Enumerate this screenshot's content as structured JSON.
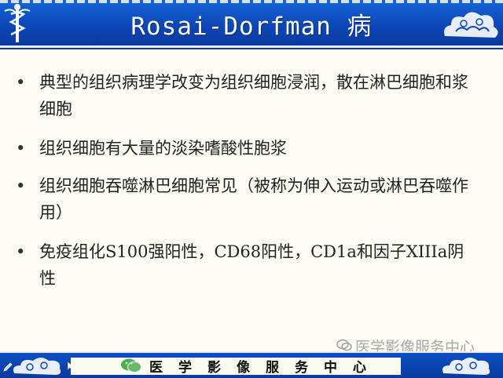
{
  "slide": {
    "title": "Rosai-Dorfman 病",
    "bullets": [
      {
        "marker": "•",
        "text": "典型的组织病理学改变为组织细胞浸润，散在淋巴细胞和浆细胞"
      },
      {
        "marker": "•",
        "text": "组织细胞有大量的淡染嗜酸性胞浆"
      },
      {
        "marker": "•",
        "text": "组织细胞吞噬淋巴细胞常见（被称为伸入运动或淋巴吞噬作用）"
      },
      {
        "marker": "•",
        "text": "免疫组化S100强阳性，CD68阳性，CD1a和因子XIIIa阴性"
      }
    ]
  },
  "footer": {
    "text": "医学影像服务中心"
  },
  "watermark": {
    "text": "医学影像服务中心"
  },
  "colors": {
    "header_blue": "#0d47b8",
    "background": "#fdfdf5",
    "text": "#222222"
  },
  "icons": [
    "caduceus-icon",
    "cloud-ornament-icon",
    "wechat-icon",
    "cursor-icon",
    "pencil-icon"
  ]
}
